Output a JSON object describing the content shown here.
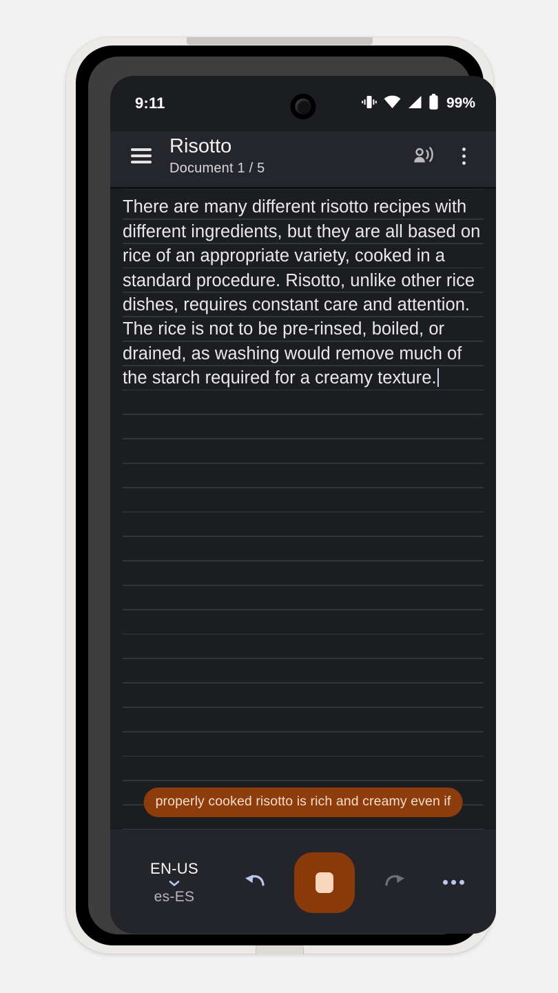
{
  "status_bar": {
    "time": "9:11",
    "battery_percent": "99%",
    "icons": [
      "vibrate-icon",
      "wifi-icon",
      "cellular-signal-icon",
      "battery-icon"
    ]
  },
  "app_bar": {
    "menu_icon": "hamburger-menu-icon",
    "title": "Risotto",
    "subtitle": "Document 1 / 5",
    "voice_icon": "voice-readaloud-icon",
    "overflow_icon": "kebab-menu-icon"
  },
  "editor": {
    "body_text": "There are many different risotto recipes with different ingredients, but they are all based on rice of an appropriate variety, cooked in a standard procedure. Risotto, unlike other rice dishes, requires constant care and attention. The rice is not to be pre-rinsed, boiled, or drained, as washing would remove much of the starch required for a creamy texture.",
    "caret_visible": true,
    "partial_transcript": "properly cooked risotto is rich and creamy even if",
    "line_color": "#3a3b40",
    "background": "#1c1d21"
  },
  "toolbar": {
    "language_from": "EN-US",
    "language_to": "es-ES",
    "language_chevron_icon": "chevron-down-icon",
    "undo_icon": "undo-arrow-icon",
    "redo_icon": "redo-arrow-icon",
    "record_icon": "stop-recording-icon",
    "more_icon": "more-options-icon",
    "accent_color": "#8a3a08",
    "stop_color": "#fad6bd",
    "undo_color": "#b9c6ef",
    "redo_color": "#6e6f75"
  },
  "navigation": {
    "home_indicator": "home-indicator"
  }
}
